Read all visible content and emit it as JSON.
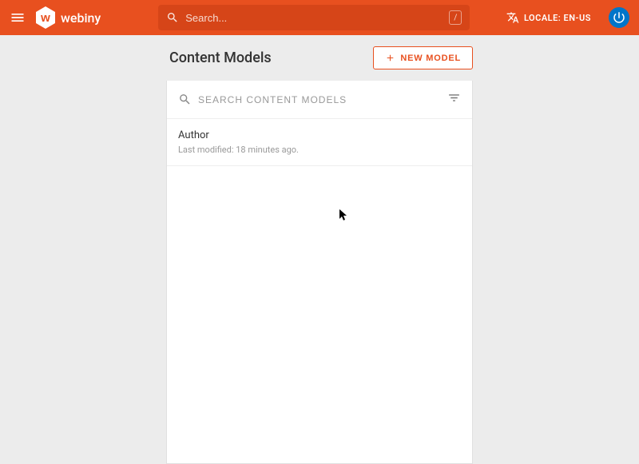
{
  "header": {
    "brand": "webiny",
    "search_placeholder": "Search...",
    "shortcut_key": "/",
    "locale_label": "LOCALE: EN-US"
  },
  "page": {
    "title": "Content Models",
    "new_button_label": "NEW MODEL",
    "search_placeholder": "SEARCH CONTENT MODELS"
  },
  "models": [
    {
      "name": "Author",
      "meta": "Last modified: 18 minutes ago."
    }
  ]
}
